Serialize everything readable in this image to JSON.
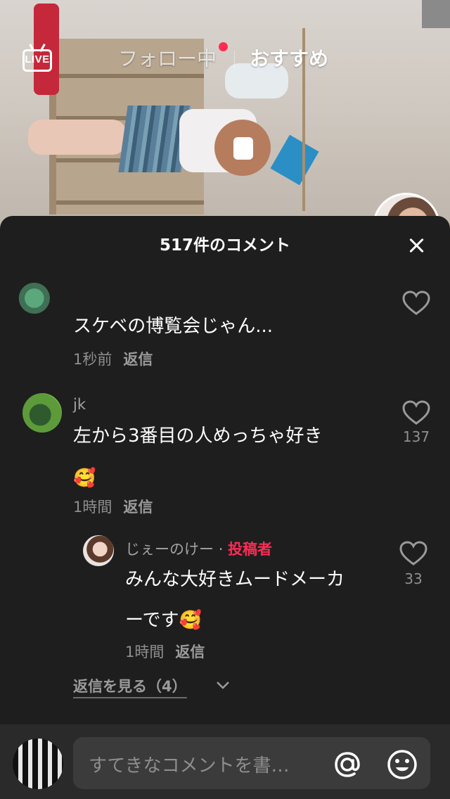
{
  "topbar": {
    "live_label": "LIVE",
    "tab_following": "フォロー中",
    "tab_recommended": "おすすめ",
    "notification_color": "#fe2c55"
  },
  "comments_sheet": {
    "title": "517件のコメント",
    "comments": [
      {
        "username": "",
        "text": "スケベの博覧会じゃん...",
        "time": "1秒前",
        "reply_label": "返信",
        "likes": ""
      },
      {
        "username": "jk",
        "text_line1": "左から3番目の人めっちゃ好き",
        "text_line2": "🥰",
        "time": "1時間",
        "reply_label": "返信",
        "likes": "137",
        "replies": [
          {
            "username": "じぇーのけー",
            "separator": "·",
            "author_tag": "投稿者",
            "text_line1": "みんな大好きムードメーカ",
            "text_line2": "ーです🥰",
            "time": "1時間",
            "reply_label": "返信",
            "likes": "33"
          }
        ]
      }
    ],
    "view_replies": "返信を見る（4）"
  },
  "input_bar": {
    "placeholder": "すてきなコメントを書…",
    "at_icon": "at-icon",
    "emoji_icon": "smiley-icon"
  }
}
